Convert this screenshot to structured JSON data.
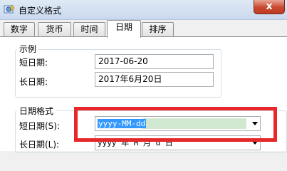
{
  "window": {
    "title": "自定义格式",
    "close_label": "x"
  },
  "tabs": [
    {
      "label": "数字"
    },
    {
      "label": "货币"
    },
    {
      "label": "时间"
    },
    {
      "label": "日期",
      "active": true
    },
    {
      "label": "排序"
    }
  ],
  "sample_group": {
    "title": "示例",
    "short_date_label": "短日期:",
    "short_date_value": "2017-06-20",
    "long_date_label": "长日期:",
    "long_date_value": "2017年6月20日"
  },
  "format_group": {
    "title": "日期格式",
    "short_date_label": "短日期(S):",
    "short_date_format": "yyyy-MM-dd",
    "long_date_label": "长日期(L):",
    "long_date_format": "yyyy'年'M'月'd'日'"
  },
  "colors": {
    "highlight_border": "#e8272b",
    "selection": "#3399ff"
  }
}
